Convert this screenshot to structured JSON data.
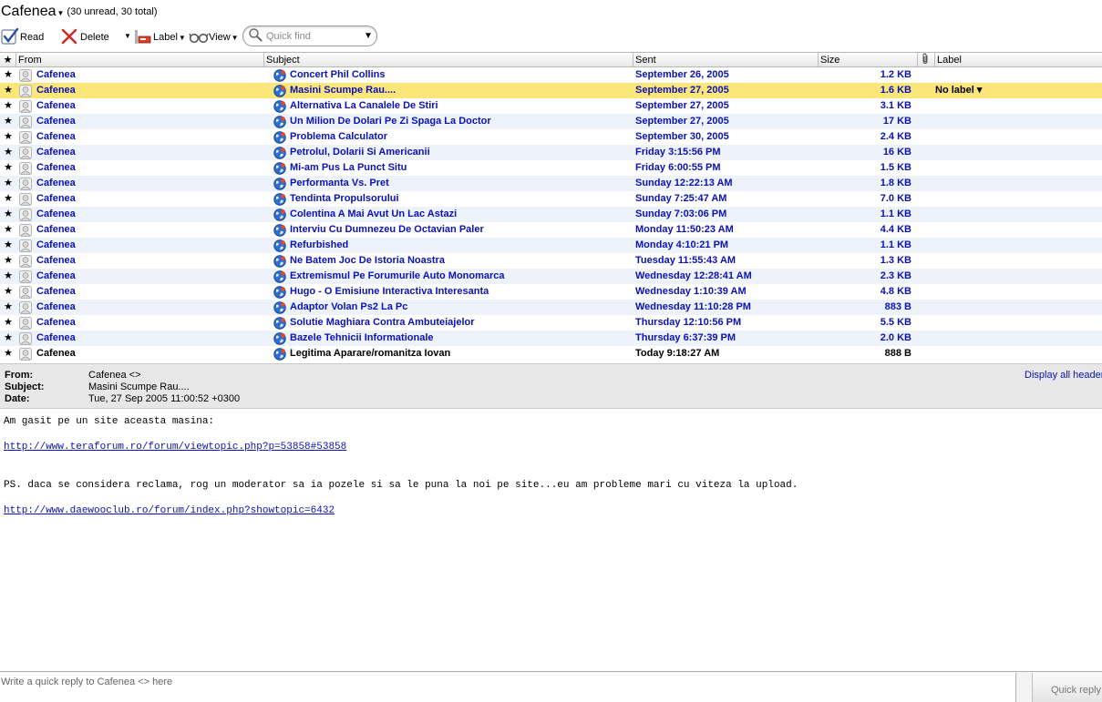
{
  "window": {
    "title": "Cafenea",
    "counts": "(30 unread, 30 total)"
  },
  "toolbar": {
    "read_label": "Read",
    "delete_label": "Delete",
    "label_label": "Label",
    "view_label": "View",
    "quickfind_placeholder": "Quick find"
  },
  "columns": {
    "star": "★",
    "from": "From",
    "subject": "Subject",
    "sent": "Sent",
    "size": "Size",
    "label": "Label"
  },
  "messages": [
    {
      "star": "★",
      "from": "Cafenea",
      "subject": "Concert Phil Collins",
      "sent": "September 26, 2005",
      "size": "1.2 KB",
      "label": ""
    },
    {
      "star": "★",
      "from": "Cafenea",
      "subject": "Masini Scumpe Rau....",
      "sent": "September 27, 2005",
      "size": "1.6 KB",
      "label": "No label ▾"
    },
    {
      "star": "★",
      "from": "Cafenea",
      "subject": "Alternativa La Canalele De Stiri",
      "sent": "September 27, 2005",
      "size": "3.1 KB",
      "label": ""
    },
    {
      "star": "★",
      "from": "Cafenea",
      "subject": "Un Milion De Dolari Pe Zi Spaga La Doctor",
      "sent": "September 27, 2005",
      "size": "17 KB",
      "label": ""
    },
    {
      "star": "★",
      "from": "Cafenea",
      "subject": "Problema Calculator",
      "sent": "September 30, 2005",
      "size": "2.4 KB",
      "label": ""
    },
    {
      "star": "★",
      "from": "Cafenea",
      "subject": "Petrolul, Dolarii Si Americanii",
      "sent": "Friday 3:15:56 PM",
      "size": "16 KB",
      "label": ""
    },
    {
      "star": "★",
      "from": "Cafenea",
      "subject": "Mi-am Pus La Punct Situ",
      "sent": "Friday 6:00:55 PM",
      "size": "1.5 KB",
      "label": ""
    },
    {
      "star": "★",
      "from": "Cafenea",
      "subject": "Performanta Vs. Pret",
      "sent": "Sunday 12:22:13 AM",
      "size": "1.8 KB",
      "label": ""
    },
    {
      "star": "★",
      "from": "Cafenea",
      "subject": "Tendinta Propulsorului",
      "sent": "Sunday 7:25:47 AM",
      "size": "7.0 KB",
      "label": ""
    },
    {
      "star": "★",
      "from": "Cafenea",
      "subject": "Colentina A Mai Avut Un Lac Astazi",
      "sent": "Sunday 7:03:06 PM",
      "size": "1.1 KB",
      "label": ""
    },
    {
      "star": "★",
      "from": "Cafenea",
      "subject": "Interviu Cu Dumnezeu De Octavian Paler",
      "sent": "Monday 11:50:23 AM",
      "size": "4.4 KB",
      "label": ""
    },
    {
      "star": "★",
      "from": "Cafenea",
      "subject": "Refurbished",
      "sent": "Monday 4:10:21 PM",
      "size": "1.1 KB",
      "label": ""
    },
    {
      "star": "★",
      "from": "Cafenea",
      "subject": "Ne Batem Joc De Istoria Noastra",
      "sent": "Tuesday 11:55:43 AM",
      "size": "1.3 KB",
      "label": ""
    },
    {
      "star": "★",
      "from": "Cafenea",
      "subject": "Extremismul Pe Forumurile Auto Monomarca",
      "sent": "Wednesday 12:28:41 AM",
      "size": "2.3 KB",
      "label": ""
    },
    {
      "star": "★",
      "from": "Cafenea",
      "subject": "Hugo - O Emisiune Interactiva Interesanta",
      "sent": "Wednesday 1:10:39 AM",
      "size": "4.8 KB",
      "label": ""
    },
    {
      "star": "★",
      "from": "Cafenea",
      "subject": "Adaptor Volan Ps2 La Pc",
      "sent": "Wednesday 11:10:28 PM",
      "size": "883 B",
      "label": ""
    },
    {
      "star": "★",
      "from": "Cafenea",
      "subject": "Solutie Maghiara Contra Ambuteiajelor",
      "sent": "Thursday 12:10:56 PM",
      "size": "5.5 KB",
      "label": ""
    },
    {
      "star": "★",
      "from": "Cafenea",
      "subject": "Bazele Tehnicii Informationale",
      "sent": "Thursday 6:37:39 PM",
      "size": "2.0 KB",
      "label": ""
    },
    {
      "star": "★",
      "from": "Cafenea",
      "subject": "Legitima Aparare/romanitza Iovan",
      "sent": "Today 9:18:27 AM",
      "size": "888 B",
      "label": ""
    }
  ],
  "header_panel": {
    "from_key": "From:",
    "from_val": "Cafenea <>",
    "subject_key": "Subject:",
    "subject_val": "Masini Scumpe Rau....",
    "date_key": "Date:",
    "date_val": "Tue, 27 Sep 2005 11:00:52 +0300",
    "display_all": "Display all headers"
  },
  "body": {
    "line1": "Am gasit pe un site aceasta masina:",
    "link1": "http://www.teraforum.ro/forum/viewtopic.php?p=53858#53858",
    "line2": "PS. daca se considera reclama, rog un moderator sa ia pozele si sa le puna la noi pe site...eu am probleme mari cu viteza la upload.",
    "link2": "http://www.daewooclub.ro/forum/index.php?showtopic=6432"
  },
  "quick_reply": {
    "placeholder": "Write a quick reply to Cafenea <> here",
    "button_label": "Quick reply"
  },
  "colors": {
    "unread_text": "#0a12b5",
    "selected_row": "#fbe67a",
    "alt_row": "#eef3fb"
  },
  "selected_index": 1,
  "read_indices": [
    18
  ]
}
